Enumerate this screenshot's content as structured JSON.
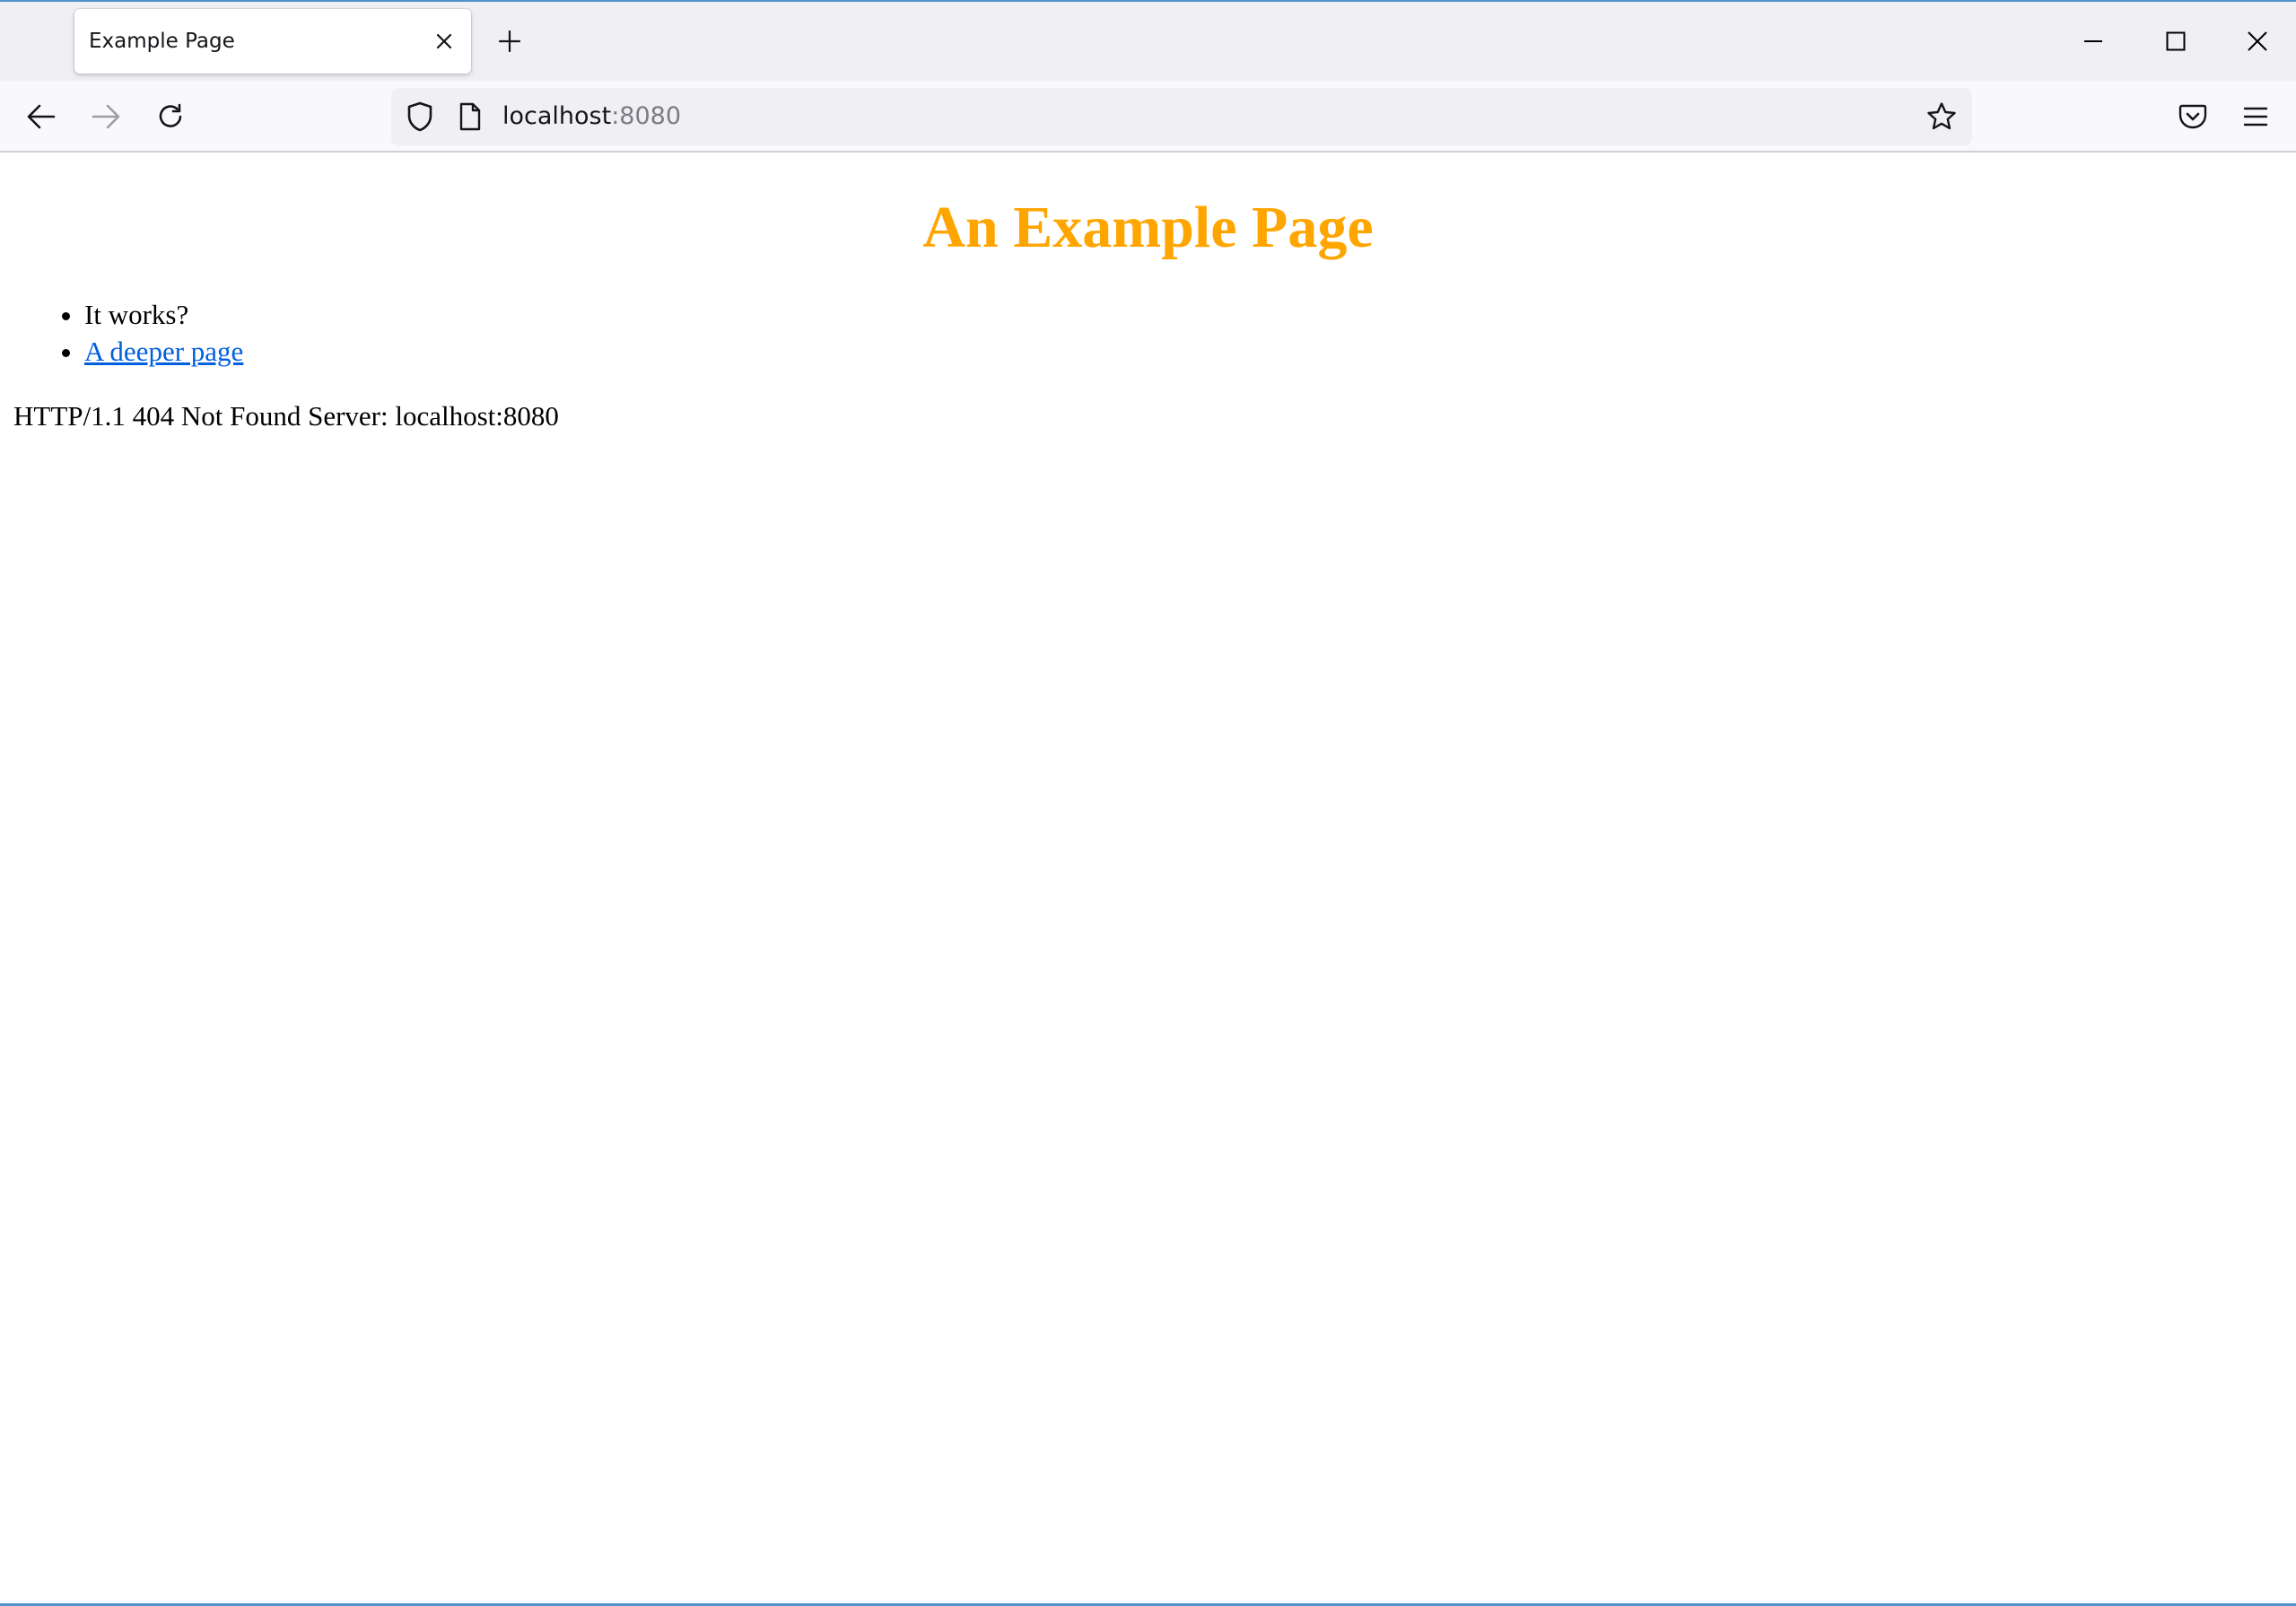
{
  "browser": {
    "tab": {
      "title": "Example Page"
    },
    "urlbar": {
      "host": "localhost",
      "port": ":8080"
    },
    "icons": {
      "tab_close": "close-icon",
      "new_tab": "plus-icon",
      "minimize": "minimize-icon",
      "maximize": "maximize-icon",
      "close_window": "close-icon",
      "back": "arrow-left-icon",
      "forward": "arrow-right-icon",
      "reload": "reload-icon",
      "tracking_protection": "shield-icon",
      "page_info": "page-icon",
      "bookmark": "star-icon",
      "pocket": "pocket-icon",
      "menu": "hamburger-menu-icon"
    },
    "forward_enabled": false
  },
  "page": {
    "heading": "An Example Page",
    "heading_color": "#ffa500",
    "list_items": [
      {
        "text": "It works?"
      },
      {
        "link_text": "A deeper page"
      }
    ],
    "link_color": "#0060df",
    "status_line": "HTTP/1.1 404 Not Found Server: localhost:8080"
  }
}
